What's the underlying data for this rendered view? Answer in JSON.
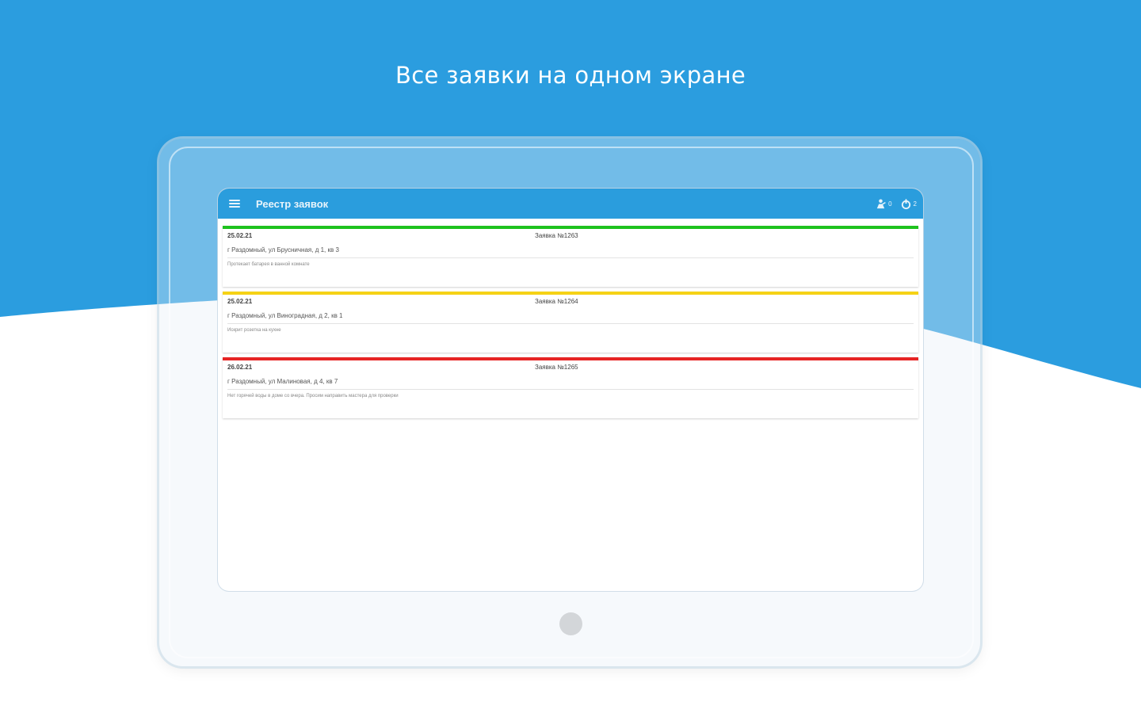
{
  "headline": "Все заявки на одном экране",
  "app": {
    "title": "Реестр заявок",
    "actions": [
      {
        "icon": "worker-icon",
        "count": "0"
      },
      {
        "icon": "emergency-icon",
        "count": "2"
      }
    ]
  },
  "requests": [
    {
      "date": "25.02.21",
      "number": "Заявка №1263",
      "address": "г Раздомный, ул Брусничная, д 1, кв 3",
      "description": "Протекает батарея в ванной комнате",
      "status_color": "#1ec21e"
    },
    {
      "date": "25.02.21",
      "number": "Заявка №1264",
      "address": "г Раздомный, ул Виноградная, д 2, кв 1",
      "description": "Искрит розетка на кухне",
      "status_color": "#f5d215"
    },
    {
      "date": "26.02.21",
      "number": "Заявка №1265",
      "address": "г Раздомный, ул Малиновая, д 4, кв 7",
      "description": "Нет горячей воды в доме со вчера. Просим направить мастера для проверки",
      "status_color": "#e62424"
    }
  ],
  "colors": {
    "brand_blue": "#2a9ddd",
    "background_blue": "#2b9ddf"
  }
}
